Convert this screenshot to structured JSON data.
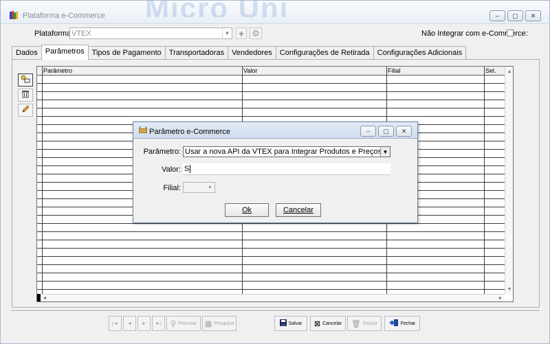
{
  "window": {
    "title": "Plataforma e-Commerce",
    "watermark": "Micro Uni"
  },
  "window_buttons": {
    "minimize": "–",
    "maximize": "▢",
    "close": "✕"
  },
  "platform": {
    "label": "Plataforma:",
    "value": "VTEX",
    "no_integrate_label": "Não Integrar com e-Commerce:",
    "no_integrate_checked": false
  },
  "tabs": [
    {
      "label": "Dados",
      "active": false
    },
    {
      "label": "Parâmetros",
      "active": true
    },
    {
      "label": "Tipos de Pagamento",
      "active": false
    },
    {
      "label": "Transportadoras",
      "active": false
    },
    {
      "label": "Vendedores",
      "active": false
    },
    {
      "label": "Configurações de Retirada",
      "active": false
    },
    {
      "label": "Configurações Adicionais",
      "active": false
    }
  ],
  "grid": {
    "columns": [
      "Parâmetro",
      "Valor",
      "Filial",
      "Sel."
    ],
    "rows": []
  },
  "side_tools": [
    {
      "icon": "add-parameter-icon"
    },
    {
      "icon": "trash-icon"
    },
    {
      "icon": "pencil-icon"
    }
  ],
  "bottom_bar": {
    "procurar": "Procurar",
    "pesquisa": "Pesquisa",
    "salvar": "Salvar",
    "cancelar": "Cancelar",
    "excluir": "Excluir",
    "fechar": "Fechar"
  },
  "dialog": {
    "title": "Parâmetro e-Commerce",
    "parametro_label": "Parâmetro:",
    "parametro_value": "Usar a nova API da VTEX para Integrar Produtos e Preços?",
    "valor_label": "Valor:",
    "valor_value": "S",
    "filial_label": "Filial:",
    "filial_value": "",
    "ok_label": "Ok",
    "cancel_label": "Cancelar"
  }
}
